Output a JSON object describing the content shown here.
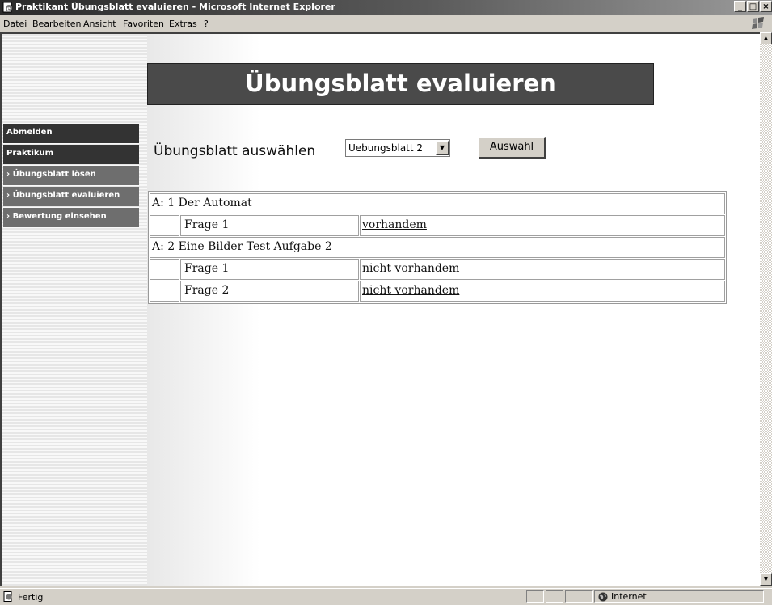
{
  "window": {
    "title": "Praktikant Übungsblatt evaluieren - Microsoft Internet Explorer",
    "controls": [
      "_",
      "□",
      "×"
    ]
  },
  "menu": [
    {
      "label": "Datei"
    },
    {
      "label": "Bearbeiten"
    },
    {
      "label": "Ansicht"
    },
    {
      "label": "Favoriten"
    },
    {
      "label": "Extras"
    },
    {
      "label": "?"
    }
  ],
  "page": {
    "heading": "Übungsblatt evaluieren",
    "nav": [
      {
        "label": "Abmelden"
      },
      {
        "label": "Praktikum"
      },
      {
        "label": "› Übungsblatt lösen"
      },
      {
        "label": "› Übungsblatt evaluieren"
      },
      {
        "label": "› Bewertung einsehen"
      }
    ],
    "select_label": "Übungsblatt auswählen",
    "select_value": "Uebungsblatt 2",
    "select_button": "Auswahl",
    "table": {
      "rows": [
        {
          "type": "task",
          "text": "A: 1 Der Automat"
        },
        {
          "type": "question",
          "question": "Frage 1",
          "status": "vorhandem"
        },
        {
          "type": "task",
          "text": "A: 2 Eine Bilder Test Aufgabe 2"
        },
        {
          "type": "question",
          "question": "Frage 1",
          "status": "nicht vorhandem"
        },
        {
          "type": "question",
          "question": "Frage 2",
          "status": "nicht vorhandem"
        }
      ]
    }
  },
  "status": {
    "text": "Fertig",
    "zone": "Internet"
  },
  "icons": {
    "title_icon": "ie-page-icon",
    "status_icon": "page-done-icon",
    "zone_icon": "globe-icon",
    "brand": "windows-logo-icon"
  }
}
